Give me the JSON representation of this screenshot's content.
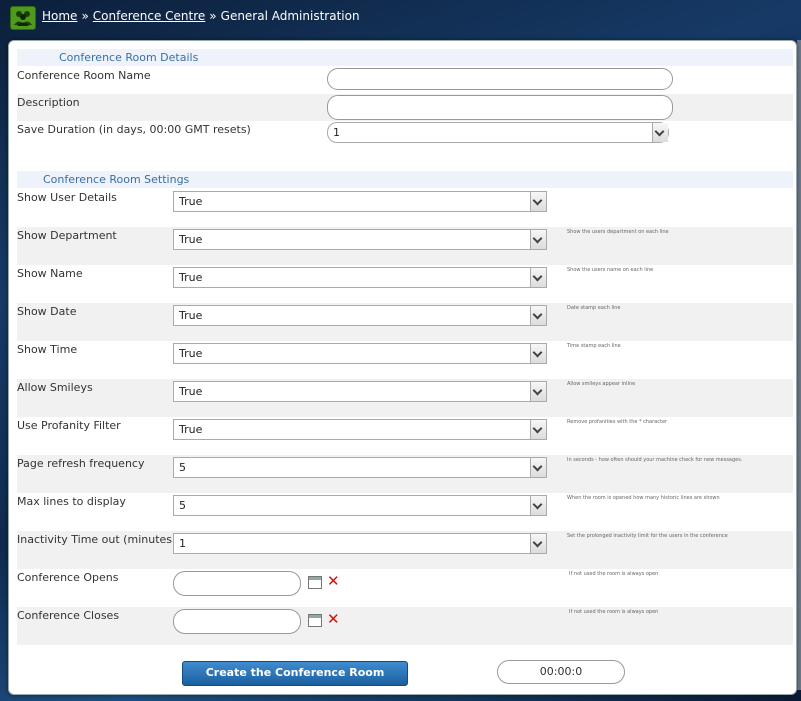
{
  "breadcrumb": {
    "home": "Home",
    "sep1": "»",
    "conference_centre": "Conference Centre",
    "sep2": "»",
    "current": "General Administration"
  },
  "details": {
    "heading": "Conference Room Details",
    "room_name_label": "Conference Room Name",
    "room_name_value": "",
    "description_label": "Description",
    "description_value": "",
    "save_duration_label": "Save Duration (in days, 00:00 GMT resets)",
    "save_duration_value": "1"
  },
  "settings": {
    "heading": "Conference Room Settings",
    "rows": [
      {
        "label": "Show User Details",
        "value": "True",
        "hint": ""
      },
      {
        "label": "Show Department",
        "value": "True",
        "hint": "Show the users department on each line"
      },
      {
        "label": "Show Name",
        "value": "True",
        "hint": "Show the users name on each line"
      },
      {
        "label": "Show Date",
        "value": "True",
        "hint": "Date stamp each line"
      },
      {
        "label": "Show Time",
        "value": "True",
        "hint": "Time stamp each line"
      },
      {
        "label": "Allow Smileys",
        "value": "True",
        "hint": "Allow smileys appear inline"
      },
      {
        "label": "Use Profanity Filter",
        "value": "True",
        "hint": "Remove profanities with the * character"
      },
      {
        "label": "Page refresh frequency",
        "value": "5",
        "hint": "In seconds - how often should your machine check for new messages."
      },
      {
        "label": "Max lines to display",
        "value": "5",
        "hint": "When the room is opened how many historic lines are shown"
      },
      {
        "label": "Inactivity Time out (minutes)",
        "value": "1",
        "hint": "Set the prolonged inactivity limit for the users in the conference"
      }
    ],
    "opens_label": "Conference Opens",
    "opens_value": "",
    "opens_hint": "If not used the room is always open",
    "closes_label": "Conference Closes",
    "closes_value": "",
    "closes_hint": "If not used the room is always open"
  },
  "actions": {
    "create_label": "Create the Conference Room",
    "timer_value": "00:00:0"
  },
  "icons": {
    "home": "people-group-icon",
    "calendar": "calendar-icon",
    "clear": "clear-x-icon"
  },
  "colors": {
    "accent": "#3a6ea5",
    "button": "#2a73b6",
    "clear": "#d01010",
    "home_icon": "#4e9a1e"
  }
}
